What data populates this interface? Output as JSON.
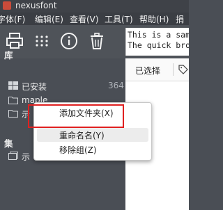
{
  "window": {
    "title": "nexusfont"
  },
  "menu": [
    "字体(F)",
    "编辑(E)",
    "查看(V)",
    "工具(T)",
    "帮助(H)",
    "捐"
  ],
  "toolbar": {
    "icons": [
      "printer-icon",
      "grid-dots-icon",
      "info-icon",
      "trash-icon"
    ]
  },
  "sample": {
    "line1": "This is a sample",
    "line2": "The quick brow"
  },
  "library": {
    "heading": "库",
    "installed_label": "已安装",
    "installed_count": "364",
    "folder1_label": "maple",
    "folder2_label": "示"
  },
  "collections": {
    "heading": "集",
    "item_label": "示"
  },
  "right_panel": {
    "selected_label": "已选择"
  },
  "context_menu": {
    "add_folder": "添加文件夹(X)",
    "rename": "重命名名(Y)",
    "remove_group": "移除组(Z)"
  }
}
